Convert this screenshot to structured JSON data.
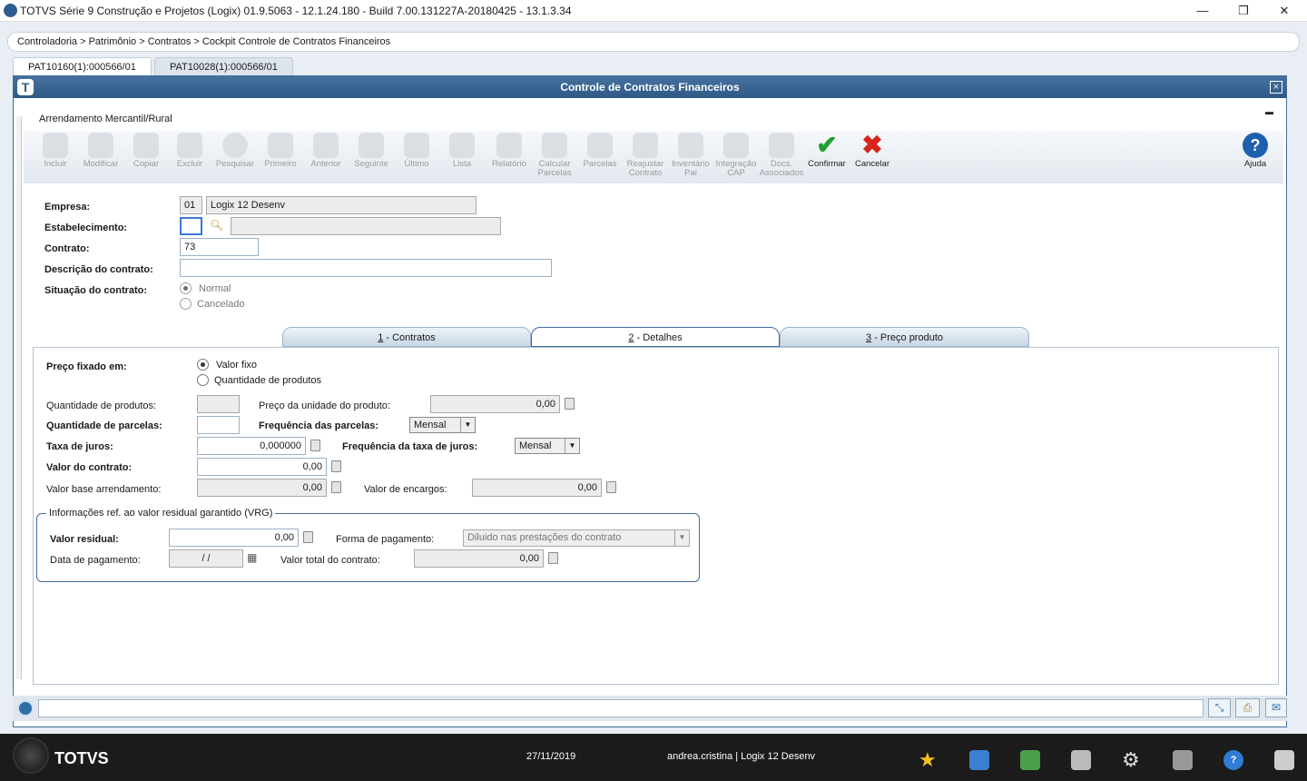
{
  "window": {
    "title": "TOTVS Série 9 Construção e Projetos (Logix) 01.9.5063  -  12.1.24.180 - Build 7.00.131227A-20180425 - 13.1.3.34",
    "minimize": "—",
    "restore": "❐",
    "close": "✕"
  },
  "breadcrumb": "Controladoria > Patrimônio > Contratos > Cockpit Controle de Contratos Financeiros",
  "doc_tabs": [
    {
      "label": "PAT10160(1):000566/01"
    },
    {
      "label": "PAT10028(1):000566/01"
    }
  ],
  "frame": {
    "title": "Controle de Contratos Financeiros",
    "logo": "T",
    "close": "×",
    "panel_title": "Arrendamento Mercantil/Rural",
    "collapse": "▬"
  },
  "toolbar": [
    {
      "label": "Incluir"
    },
    {
      "label": "Modificar"
    },
    {
      "label": "Copiar"
    },
    {
      "label": "Excluir"
    },
    {
      "label": "Pesquisar"
    },
    {
      "label": "Primeiro"
    },
    {
      "label": "Anterior"
    },
    {
      "label": "Seguinte"
    },
    {
      "label": "Último"
    },
    {
      "label": "Lista"
    },
    {
      "label": "Relatório"
    },
    {
      "label": "Calcular Parcelas"
    },
    {
      "label": "Parcelas"
    },
    {
      "label": "Reajustar Contrato"
    },
    {
      "label": "Inventário Pai"
    },
    {
      "label": "Integração CAP"
    },
    {
      "label": "Docs. Associados"
    },
    {
      "label": "Confirmar"
    },
    {
      "label": "Cancelar"
    },
    {
      "label": "Ajuda"
    }
  ],
  "header_form": {
    "empresa_label": "Empresa:",
    "empresa_code": "01",
    "empresa_name": "Logix 12 Desenv",
    "estab_label": "Estabelecimento:",
    "estab_value": "",
    "estab_desc": "",
    "contrato_label": "Contrato:",
    "contrato_value": "73",
    "descricao_label": "Descrição do contrato:",
    "descricao_value": "",
    "situacao_label": "Situação do contrato:",
    "situacao_options": [
      "Normal",
      "Cancelado"
    ]
  },
  "tabs": [
    {
      "key": "1",
      "label": " - Contratos"
    },
    {
      "key": "2",
      "label": " - Detalhes"
    },
    {
      "key": "3",
      "label": " - Preço produto"
    }
  ],
  "details": {
    "preco_fixado_label": "Preço fixado em:",
    "preco_opts": [
      "Valor fixo",
      "Quantidade de produtos"
    ],
    "qtd_produtos_label": "Quantidade de produtos:",
    "qtd_produtos_value": "",
    "preco_unidade_label": "Preço da unidade do produto:",
    "preco_unidade_value": "0,00",
    "qtd_parcelas_label": "Quantidade de parcelas:",
    "qtd_parcelas_value": "",
    "freq_parcelas_label": "Frequência das parcelas:",
    "freq_parcelas_value": "Mensal",
    "taxa_juros_label": "Taxa de juros:",
    "taxa_juros_value": "0,000000",
    "freq_taxa_label": "Frequência da taxa de juros:",
    "freq_taxa_value": "Mensal",
    "valor_contrato_label": "Valor do contrato:",
    "valor_contrato_value": "0,00",
    "valor_base_label": "Valor base arrendamento:",
    "valor_base_value": "0,00",
    "valor_encargos_label": "Valor de encargos:",
    "valor_encargos_value": "0,00"
  },
  "vrg": {
    "legend": "Informações ref. ao valor residual garantido (VRG)",
    "valor_residual_label": "Valor residual:",
    "valor_residual_value": "0,00",
    "forma_pagamento_label": "Forma de pagamento:",
    "forma_pagamento_value": "Diluido nas prestações do contrato",
    "data_pagamento_label": "Data de pagamento:",
    "data_pagamento_value": "/ /",
    "valor_total_label": "Valor total do contrato:",
    "valor_total_value": "0,00"
  },
  "taskbar": {
    "brand": "TOTVS",
    "date": "27/11/2019",
    "user": "andrea.cristina | Logix 12 Desenv"
  }
}
